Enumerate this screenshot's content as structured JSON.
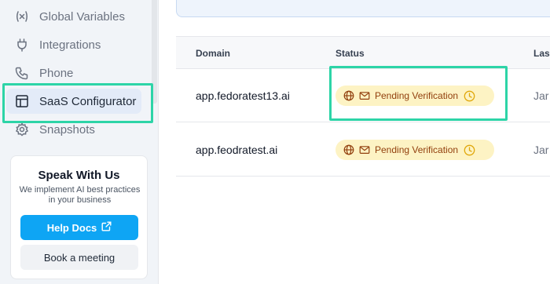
{
  "sidebar": {
    "items": [
      {
        "label": "Global Variables",
        "icon": "variable-icon"
      },
      {
        "label": "Integrations",
        "icon": "plug-icon"
      },
      {
        "label": "Phone",
        "icon": "phone-icon"
      },
      {
        "label": "SaaS Configurator",
        "icon": "layout-icon",
        "active": true
      },
      {
        "label": "Snapshots",
        "icon": "gear-icon"
      }
    ]
  },
  "promo": {
    "title": "Speak With Us",
    "subtitle": "We implement AI best practices in your business",
    "help_docs_label": "Help Docs",
    "book_meeting_label": "Book a meeting"
  },
  "table": {
    "columns": [
      "Domain",
      "Status",
      "Las"
    ],
    "rows": [
      {
        "domain": "app.fedoratest13.ai",
        "status": "Pending Verification",
        "last": "Jar"
      },
      {
        "domain": "app.feodratest.ai",
        "status": "Pending Verification",
        "last": "Jar"
      }
    ]
  },
  "colors": {
    "accent": "#0ea5f4",
    "highlight": "#2dd4a7",
    "badge_bg": "#fdf3c4",
    "badge_text": "#92400e",
    "active_item_bg": "#e3ebf8"
  }
}
